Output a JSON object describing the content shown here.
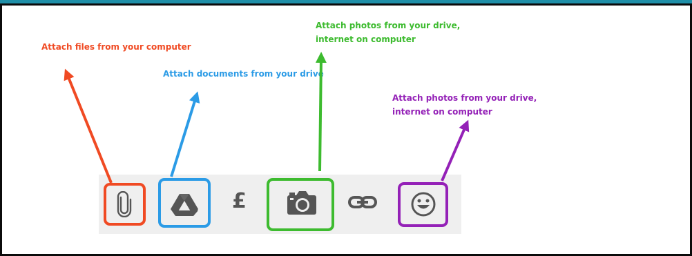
{
  "annotations": {
    "attach_files": "Attach files from your computer",
    "attach_documents": "Attach documents from your drive",
    "attach_photos_green": "Attach photos from your drive,\ninternet on computer",
    "attach_photos_purple": "Attach photos from your drive,\ninternet on computer"
  },
  "toolbar": {
    "icons": [
      "paperclip-icon",
      "google-drive-icon",
      "pound-sign-icon",
      "camera-icon",
      "link-icon",
      "smiley-icon"
    ],
    "pound_symbol": "£"
  },
  "colors": {
    "header_bar": "#1f8fa8",
    "red": "#f04a23",
    "blue": "#2b9be6",
    "green": "#3dbb2f",
    "purple": "#9421b7",
    "icon_gray": "#555555",
    "toolbar_bg": "#efefef"
  }
}
